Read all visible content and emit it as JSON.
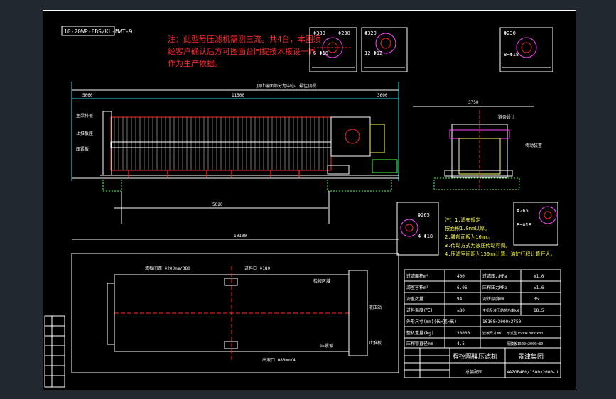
{
  "drawing": {
    "tag": "10-20WP-FBS/KL-MWT-9",
    "note_lines": [
      "注：此型号压滤机需测三流。共4台，本图须",
      "经客户确认后方可图面台同提技术接设一同",
      "作为生产依据。"
    ],
    "label_top": "顶止端面部分为中心、最佳顶视",
    "dims": {
      "top_left": "5060",
      "total_top": "11500",
      "right_top": "3600",
      "bottom_span": "5020",
      "bottom_total": "10100",
      "side_width": "3750"
    },
    "callouts_left": [
      "主梁排板",
      "止推板座",
      "压紧板"
    ],
    "right_view_labels": [
      "链条设计",
      "传动装置"
    ],
    "notes": {
      "lines": [
        "注：1.滤布规定",
        "  按面积1.0mm以厚。",
        "  2.腰部面板为16mm。",
        "  3.传动方式为液压传动可调。",
        "  4.压滤室间距为150mm计算，油缸行程计算开大。"
      ]
    },
    "detail_labels": {
      "d1a": "Φ380",
      "d1b": "Φ230",
      "d1c": "6~Φ18",
      "d2a": "Φ320",
      "d2b": "12~Φ12",
      "d3a": "Φ230",
      "d3b": "8~Φ18",
      "d4a": "Φ265",
      "d4b": "4~Φ18",
      "d5a": "Φ265",
      "d5b": "8~Φ18"
    },
    "plan_labels": [
      "滤板间距 Φ200mm/380",
      "进料口 Φ180",
      "检修区域",
      "液压站",
      "止推板",
      "压紧板",
      "出液口 Φ80mm/4"
    ],
    "spec_table": {
      "rows": [
        [
          "过滤面积m²",
          "400",
          "过滤压力MPa",
          "≤1.0"
        ],
        [
          "滤室容积m³",
          "6.06",
          "压榨压力MPa",
          "≤1.6"
        ],
        [
          "滤室数量",
          "94",
          "滤饼厚度mm",
          "35"
        ],
        [
          "进料温度(℃)",
          "≤80",
          "主机及液压站总功率kW",
          "18.5"
        ],
        [
          "外形尺寸(mm)(长×宽×高)",
          "",
          "10100×2000×2750",
          ""
        ],
        [
          "整机重量(kg)",
          "38000",
          "滤板尺寸mm",
          "形式型1500×2000×80"
        ],
        [
          "压榨管直径mm",
          "4.5",
          "",
          "隔膜板1500×2000×80"
        ]
      ]
    },
    "title_block": {
      "title": "程控隔膜压滤机",
      "company": "景津集团",
      "model": "XAZGF400/1500×2000-U",
      "sheet": "总装配图"
    },
    "side_table": [
      "",
      "",
      "",
      "",
      "",
      "",
      ""
    ],
    "colors": {
      "red": "#ff2a2a",
      "white": "#ffffff",
      "yellow": "#ffff55",
      "green": "#4cff4c",
      "cyan": "#33e0e0",
      "magenta": "#ff44ff",
      "blue": "#4b6bff"
    }
  }
}
